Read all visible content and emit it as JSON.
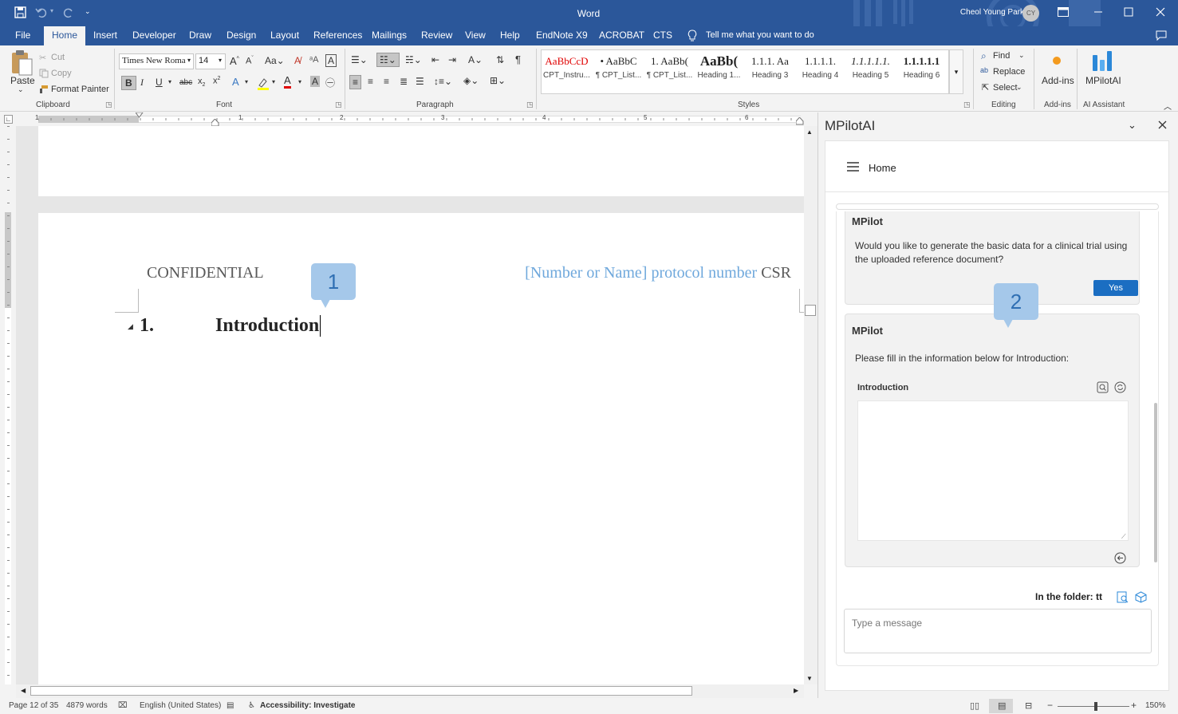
{
  "titlebar": {
    "app_title": "Word",
    "user_name": "Cheol Young Park",
    "user_initials": "CY"
  },
  "tabs": [
    {
      "label": "File"
    },
    {
      "label": "Home"
    },
    {
      "label": "Insert"
    },
    {
      "label": "Developer"
    },
    {
      "label": "Draw"
    },
    {
      "label": "Design"
    },
    {
      "label": "Layout"
    },
    {
      "label": "References"
    },
    {
      "label": "Mailings"
    },
    {
      "label": "Review"
    },
    {
      "label": "View"
    },
    {
      "label": "Help"
    },
    {
      "label": "EndNote X9"
    },
    {
      "label": "ACROBAT"
    },
    {
      "label": "CTS"
    }
  ],
  "tell_me": "Tell me what you want to do",
  "ribbon": {
    "clipboard": {
      "paste": "Paste",
      "cut": "Cut",
      "copy": "Copy",
      "format_painter": "Format Painter",
      "label": "Clipboard"
    },
    "font": {
      "font_name": "Times New Roma",
      "font_size": "14",
      "label": "Font"
    },
    "paragraph": {
      "label": "Paragraph"
    },
    "styles": {
      "label": "Styles",
      "items": [
        {
          "preview": "AaBbCcD",
          "name": "CPT_Instru..."
        },
        {
          "preview": "• AaBbC",
          "name": "¶ CPT_List..."
        },
        {
          "preview": "1. AaBb(",
          "name": "¶ CPT_List..."
        },
        {
          "preview": "AaBb(",
          "name": "Heading 1..."
        },
        {
          "preview": "1.1.1. Aa",
          "name": "Heading 3"
        },
        {
          "preview": "1.1.1.1.",
          "name": "Heading 4"
        },
        {
          "preview": "1.1.1.1.1.",
          "name": "Heading 5"
        },
        {
          "preview": "1.1.1.1.1",
          "name": "Heading 6"
        }
      ]
    },
    "editing": {
      "find": "Find",
      "replace": "Replace",
      "select": "Select",
      "label": "Editing"
    },
    "addins": {
      "button": "Add-ins",
      "label": "Add-ins"
    },
    "ai": {
      "button": "MPilotAI",
      "label": "AI Assistant"
    }
  },
  "document": {
    "header_left": "CONFIDENTIAL",
    "header_right_placeholder": "[Number or Name] protocol number",
    "header_right_suffix": "CSR",
    "heading_number": "1.",
    "heading_text": "Introduction"
  },
  "callouts": {
    "one": "1",
    "two": "2"
  },
  "pane": {
    "title": "MPilotAI",
    "nav_title": "Home",
    "msg1_sender": "MPilot",
    "msg1_text": "Would you like to generate the basic data for a clinical trial using the uploaded reference document?",
    "yes_button": "Yes",
    "msg2_sender": "MPilot",
    "msg2_text": "Please fill in the information below for Introduction:",
    "field_label": "Introduction",
    "field_value": "",
    "folder_label": "In the folder: tt",
    "message_placeholder": "Type a message"
  },
  "statusbar": {
    "page": "Page 12 of 35",
    "words": "4879 words",
    "language": "English (United States)",
    "accessibility": "Accessibility: Investigate",
    "zoom": "150%"
  },
  "ruler_numbers": [
    "1",
    "1",
    "2",
    "3",
    "4",
    "5",
    "6"
  ],
  "colors": {
    "word_blue": "#2b579a",
    "callout_blue": "#a5c8ea",
    "yes_button": "#1b6ec2",
    "placeholder_text": "#6fa8dc"
  }
}
